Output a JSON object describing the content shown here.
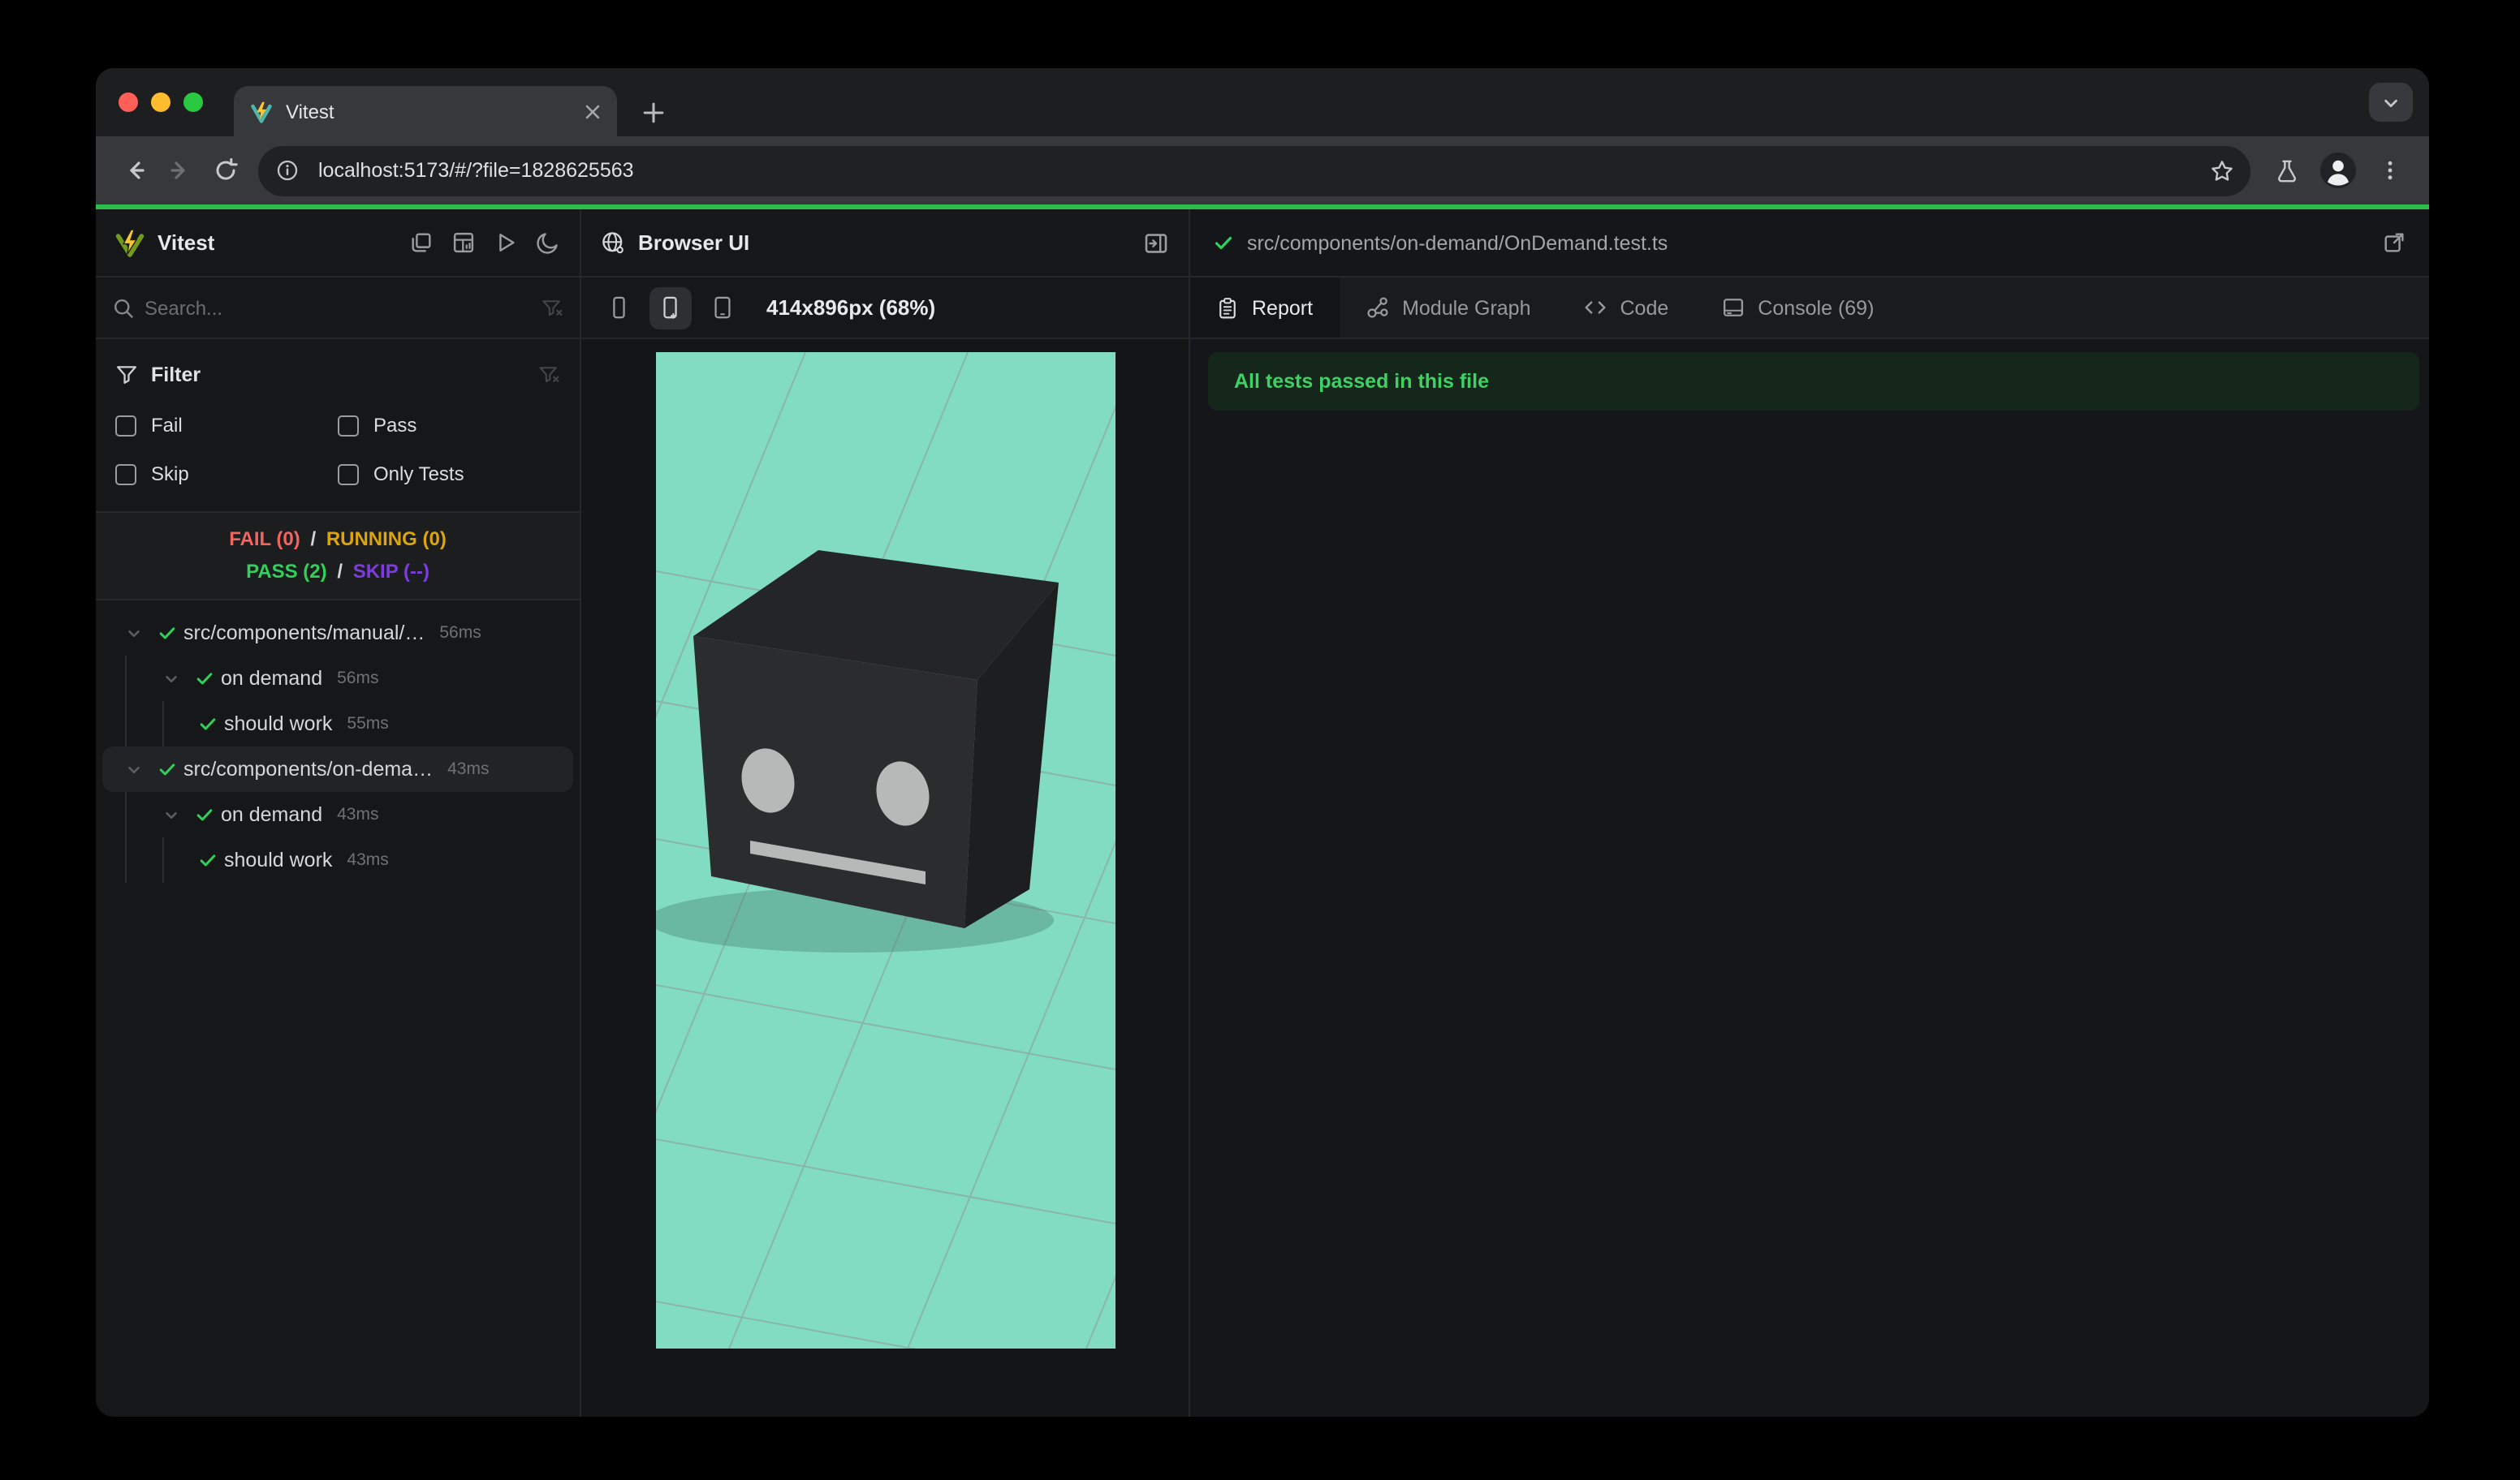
{
  "browser": {
    "tab_title": "Vitest",
    "url": "localhost:5173/#/?file=1828625563"
  },
  "sidebar": {
    "title": "Vitest",
    "search_placeholder": "Search...",
    "filter_title": "Filter",
    "filters": [
      {
        "label": "Fail"
      },
      {
        "label": "Pass"
      },
      {
        "label": "Skip"
      },
      {
        "label": "Only Tests"
      }
    ],
    "status": {
      "fail": "FAIL (0)",
      "sep1": "/",
      "running": "RUNNING (0)",
      "pass": "PASS (2)",
      "sep2": "/",
      "skip": "SKIP (--)"
    },
    "tree": [
      {
        "label": "src/components/manual/…",
        "duration": "56ms"
      },
      {
        "label": "on demand",
        "duration": "56ms"
      },
      {
        "label": "should work",
        "duration": "55ms"
      },
      {
        "label": "src/components/on-dema…",
        "duration": "43ms"
      },
      {
        "label": "on demand",
        "duration": "43ms"
      },
      {
        "label": "should work",
        "duration": "43ms"
      }
    ]
  },
  "preview": {
    "title": "Browser UI",
    "viewport_label": "414x896px (68%)"
  },
  "report": {
    "file_path": "src/components/on-demand/OnDemand.test.ts",
    "tabs": [
      {
        "label": "Report"
      },
      {
        "label": "Module Graph"
      },
      {
        "label": "Code"
      },
      {
        "label": "Console (69)"
      }
    ],
    "banner": "All tests passed in this file"
  },
  "colors": {
    "progress_green": "#2cbd4b",
    "pass_green": "#30d158",
    "fail_red": "#f4645f",
    "running_yellow": "#dca50b",
    "skip_purple": "#7d3ce0",
    "mint_viewport": "#82dcc2",
    "banner_bg": "#15261b",
    "banner_text": "#3ed163",
    "traffic_red": "#ff5f57",
    "traffic_yellow": "#febc2e",
    "traffic_green": "#28c840",
    "vitest_green": "#729b1b",
    "vitest_yellow": "#fcc72b"
  }
}
